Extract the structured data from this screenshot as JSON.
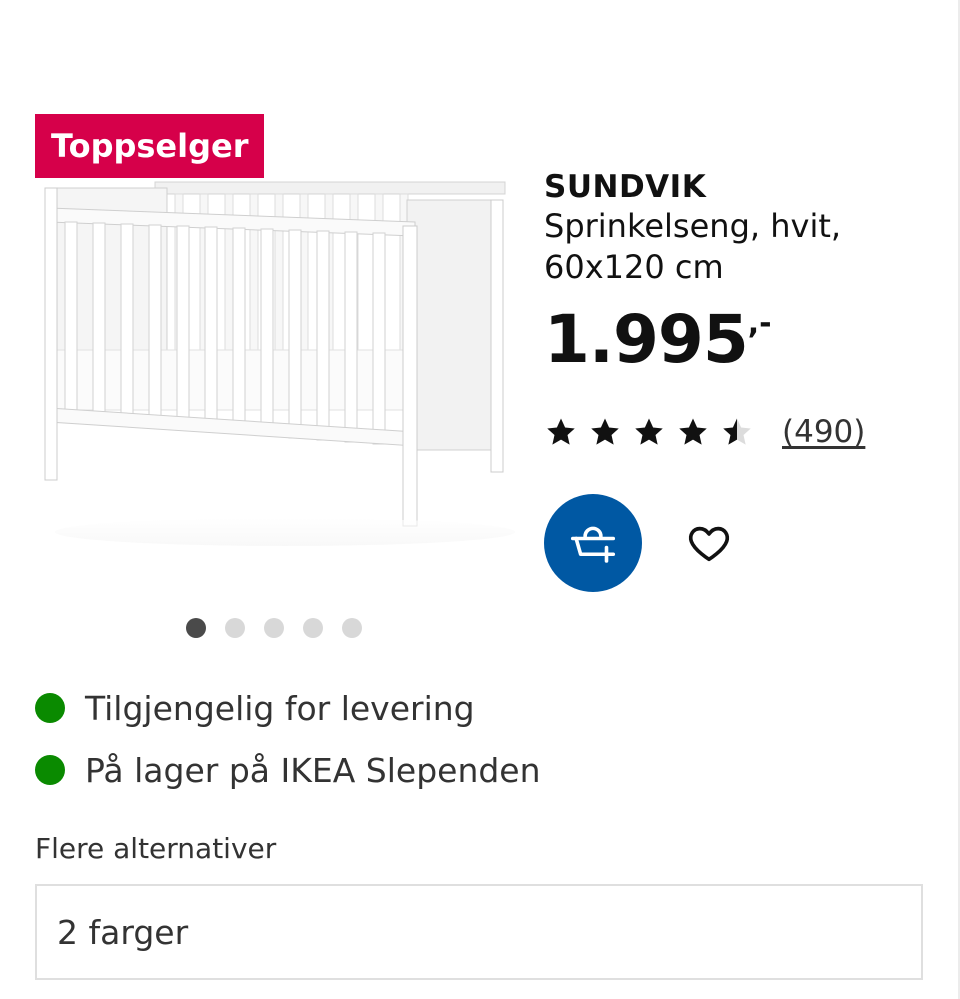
{
  "badge": {
    "label": "Toppselger"
  },
  "product": {
    "name": "SUNDVIK",
    "description_line1": "Sprinkelseng, hvit,",
    "description_line2": "60x120 cm",
    "price": "1.995",
    "price_suffix": ",-",
    "rating": {
      "value": 4.5,
      "max": 5,
      "review_count": "(490)"
    }
  },
  "gallery": {
    "dot_count": 5,
    "active_index": 0
  },
  "actions": {
    "cart_icon": "shopping-basket-add-icon",
    "favorite_icon": "heart-outline-icon"
  },
  "availability": [
    {
      "text": "Tilgjengelig for levering",
      "status_color": "#0a8a00"
    },
    {
      "text": "På lager på IKEA Slependen",
      "status_color": "#0a8a00"
    }
  ],
  "options": {
    "label": "Flere alternativer",
    "value": "2 farger"
  },
  "colors": {
    "badge": "#d6004a",
    "cart_button": "#0058a3",
    "available": "#0a8a00"
  }
}
